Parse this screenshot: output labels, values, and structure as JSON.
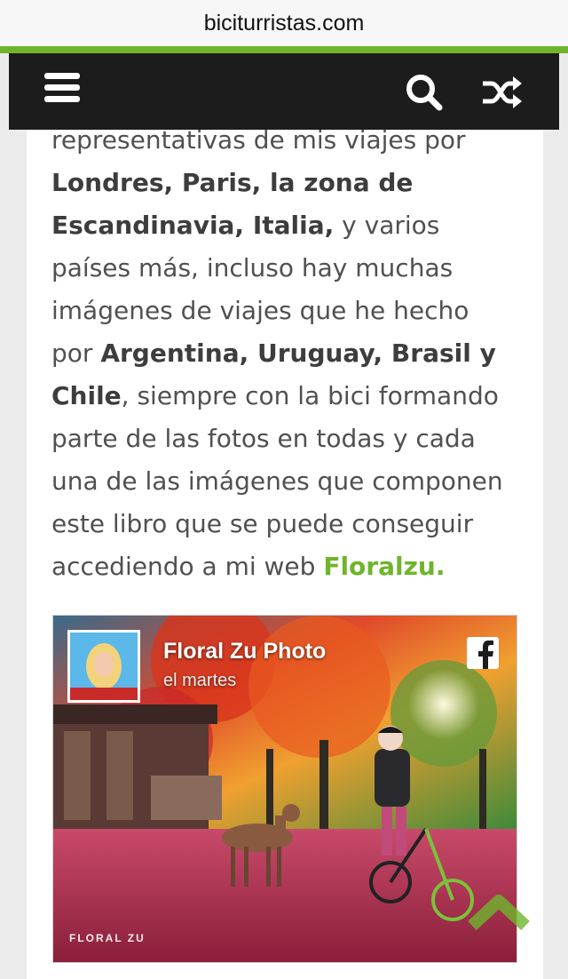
{
  "browser": {
    "url": "biciturristas.com"
  },
  "header": {
    "menu_icon": "hamburger-menu-icon",
    "search_icon": "search-icon",
    "shuffle_icon": "shuffle-icon",
    "accent_color": "#6fb52c",
    "background": "#1c1c1c"
  },
  "article": {
    "t1": "representativas de mis viajes por ",
    "b1": "Londres, Paris, la zona de Escandinavia, Italia,",
    "t2": " y varios países más, incluso hay muchas imágenes de viajes que he hecho por ",
    "b2": "Argentina, Uruguay, Brasil y Chile",
    "t3": ", siempre con la bici formando parte de las fotos en todas y cada una de las imágenes que componen este libro que se puede conseguir accediendo a mi web ",
    "link": "Floralzu."
  },
  "facebook_post": {
    "page_name": "Floral Zu Photo",
    "date": "el martes",
    "logo_icon": "facebook-icon",
    "watermark": "FLORAL ZU"
  },
  "scroll_top": {
    "icon": "chevron-up-icon",
    "color": "#6fb52c"
  }
}
